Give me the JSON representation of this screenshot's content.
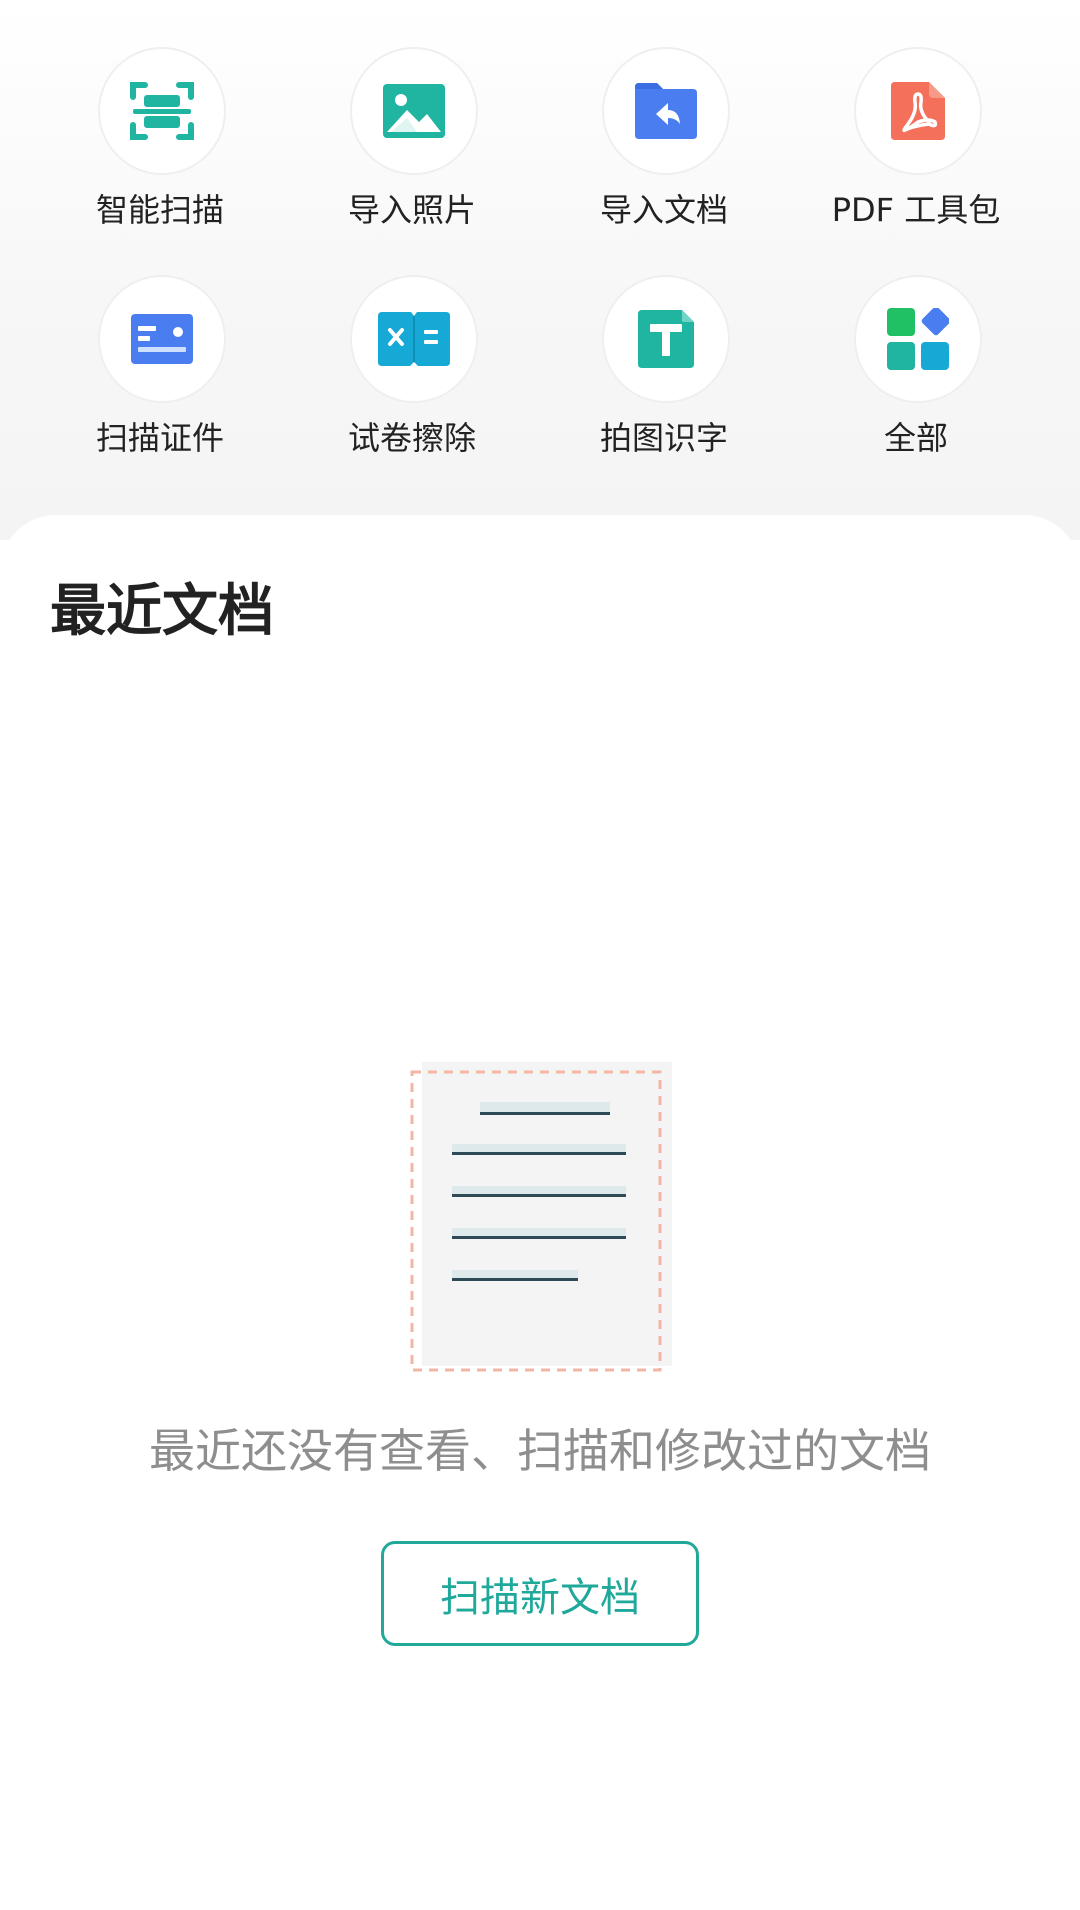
{
  "tools": [
    {
      "label": "智能扫描",
      "icon": "smart-scan-icon",
      "color": "#1fb5a1"
    },
    {
      "label": "导入照片",
      "icon": "import-photo-icon",
      "color": "#1fb5a1"
    },
    {
      "label": "导入文档",
      "icon": "import-document-icon",
      "color": "#4a7ef0"
    },
    {
      "label": "PDF 工具包",
      "icon": "pdf-toolkit-icon",
      "color": "#f4705a"
    },
    {
      "label": "扫描证件",
      "icon": "scan-id-icon",
      "color": "#4a7ef0"
    },
    {
      "label": "试卷擦除",
      "icon": "exam-erase-icon",
      "color": "#16a9d6"
    },
    {
      "label": "拍图识字",
      "icon": "text-recognition-icon",
      "color": "#1fb5a1"
    },
    {
      "label": "全部",
      "icon": "all-apps-icon",
      "color": "#1fb5a1"
    }
  ],
  "recent": {
    "title": "最近文档",
    "empty_text": "最近还没有查看、扫描和修改过的文档",
    "scan_button": "扫描新文档"
  },
  "colors": {
    "accent": "#20a99b",
    "blue": "#4a7ef0",
    "pdf": "#f4705a",
    "cyan": "#16a9d6",
    "green": "#20c064"
  }
}
